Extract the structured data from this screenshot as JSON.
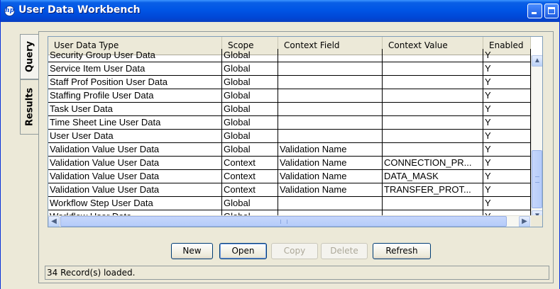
{
  "window": {
    "title": "User Data Workbench",
    "app_icon": "hp-logo-icon"
  },
  "side_tabs": [
    {
      "label": "Query",
      "selected": true
    },
    {
      "label": "Results",
      "selected": false
    }
  ],
  "table": {
    "columns": [
      "User Data Type",
      "Scope",
      "Context Field",
      "Context Value",
      "Enabled"
    ],
    "rows": [
      [
        "Security Group User Data",
        "Global",
        "",
        "",
        "Y"
      ],
      [
        "Service Item User Data",
        "Global",
        "",
        "",
        "Y"
      ],
      [
        "Staff Prof Position User Data",
        "Global",
        "",
        "",
        "Y"
      ],
      [
        "Staffing Profile User Data",
        "Global",
        "",
        "",
        "Y"
      ],
      [
        "Task User Data",
        "Global",
        "",
        "",
        "Y"
      ],
      [
        "Time Sheet Line User Data",
        "Global",
        "",
        "",
        "Y"
      ],
      [
        "User User Data",
        "Global",
        "",
        "",
        "Y"
      ],
      [
        "Validation Value User Data",
        "Global",
        "Validation Name",
        "",
        "Y"
      ],
      [
        "Validation Value User Data",
        "Context",
        "Validation Name",
        "CONNECTION_PR...",
        "Y"
      ],
      [
        "Validation Value User Data",
        "Context",
        "Validation Name",
        "DATA_MASK",
        "Y"
      ],
      [
        "Validation Value User Data",
        "Context",
        "Validation Name",
        "TRANSFER_PROT...",
        "Y"
      ],
      [
        "Workflow Step User Data",
        "Global",
        "",
        "",
        "Y"
      ],
      [
        "Workflow User Data",
        "Global",
        "",
        "",
        "Y"
      ]
    ]
  },
  "buttons": {
    "new": "New",
    "open": "Open",
    "copy": "Copy",
    "delete": "Delete",
    "refresh": "Refresh"
  },
  "status": {
    "text": "34 Record(s) loaded."
  },
  "colors": {
    "titlebar": "#0055e5",
    "window_bg": "#ece9d8",
    "scroll_thumb": "#c6d6fb"
  }
}
